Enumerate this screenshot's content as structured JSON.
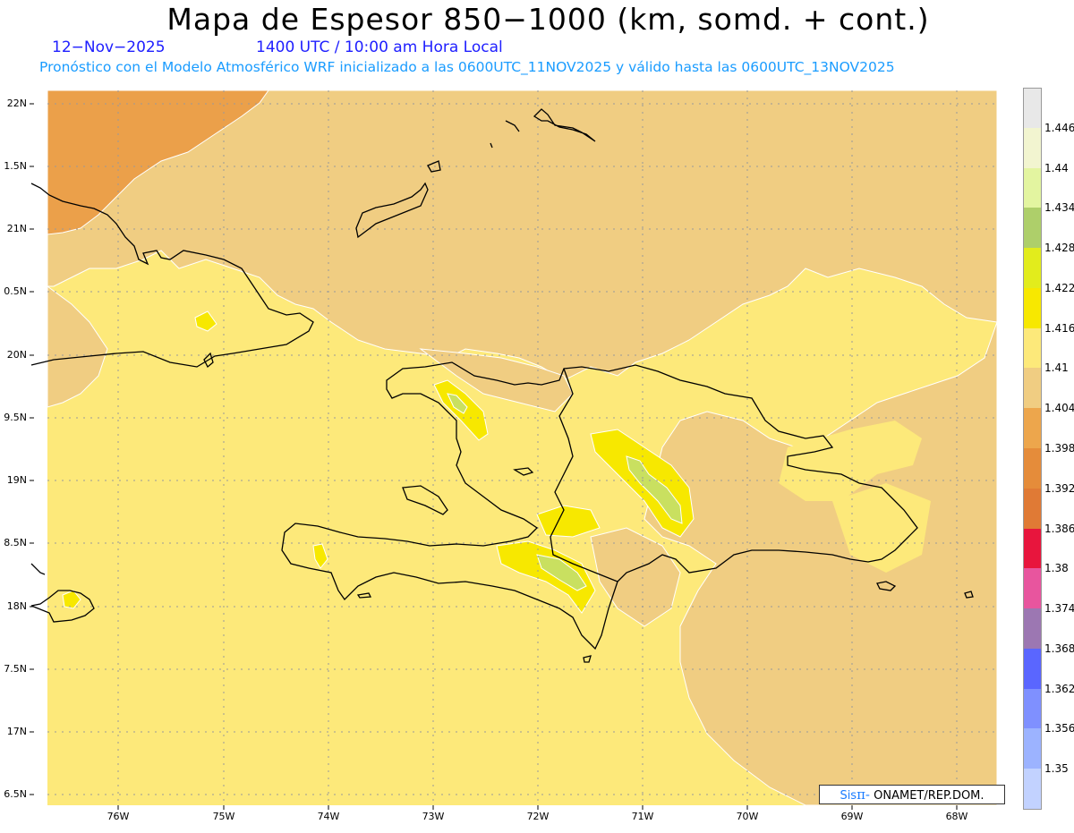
{
  "header": {
    "title": "Mapa de Espesor 850−1000 (km, somd. + cont.)",
    "date": "12−Nov−2025",
    "time": "1400 UTC / 10:00 am Hora Local",
    "subtitle": "Pronóstico con el Modelo Atmosférico WRF inicializado a las 0600UTC_11NOV2025 y válido hasta las  0600UTC_13NOV2025"
  },
  "axes": {
    "lat_labels": [
      "22N",
      "1.5N",
      "21N",
      "0.5N",
      "20N",
      "9.5N",
      "19N",
      "8.5N",
      "18N",
      "7.5N",
      "17N",
      "6.5N"
    ],
    "lon_labels": [
      "76W",
      "75W",
      "74W",
      "73W",
      "72W",
      "71W",
      "70W",
      "69W",
      "68W"
    ]
  },
  "colorbar": {
    "labels": [
      "1.446",
      "1.44",
      "1.434",
      "1.428",
      "1.422",
      "1.416",
      "1.41",
      "1.404",
      "1.398",
      "1.392",
      "1.386",
      "1.38",
      "1.374",
      "1.368",
      "1.362",
      "1.356",
      "1.35"
    ],
    "colors": [
      "#e8e8e8",
      "#f2f5d0",
      "#e3f5a0",
      "#aecf6a",
      "#e2ec1c",
      "#f7e800",
      "#fde97a",
      "#f0cd82",
      "#eda64c",
      "#e58c3a",
      "#e07a35",
      "#e8153d",
      "#e8559e",
      "#9c77b2",
      "#5a66ff",
      "#7f90ff",
      "#9cb3ff",
      "#c2d2ff"
    ]
  },
  "map": {
    "colors": {
      "darkest": "#eba04a",
      "dark": "#f0cd82",
      "base": "#fde97a",
      "yellow": "#f7e800",
      "green": "#c9e060",
      "coast": "#000000",
      "grid": "#999999"
    }
  },
  "credit": {
    "brand": "Sis",
    "pi": "π‐",
    "org": " ONAMET/REP.DOM."
  }
}
